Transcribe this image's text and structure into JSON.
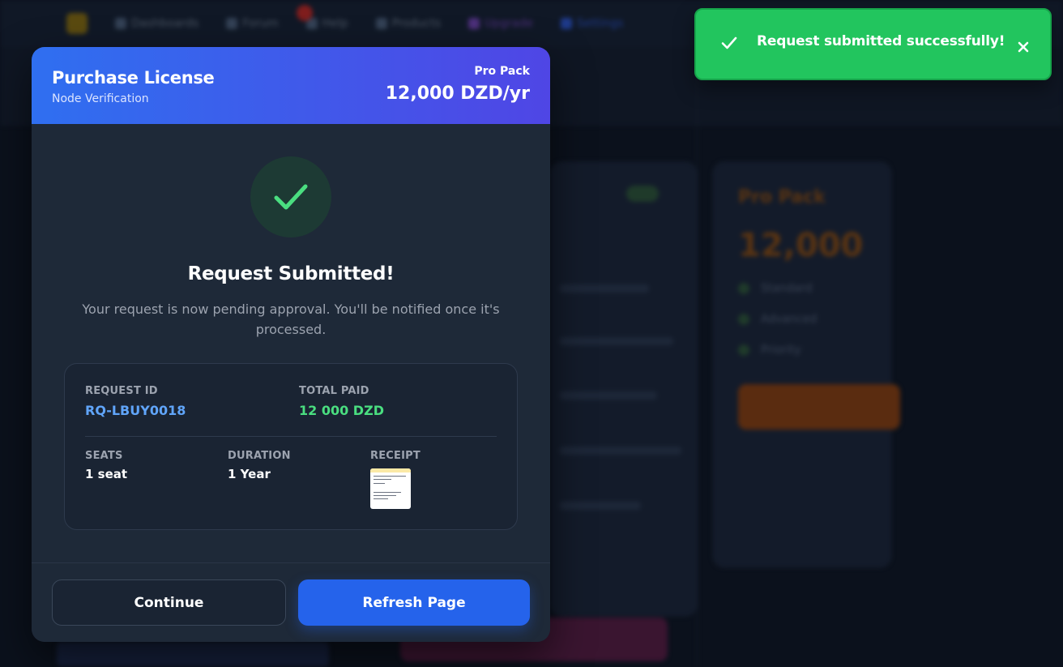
{
  "background": {
    "nav_items": [
      "Dashboards",
      "Forum",
      "Help",
      "Products",
      "Upgrade",
      "Settings"
    ]
  },
  "modal": {
    "title": "Purchase License",
    "subtitle": "Node Verification",
    "pack_label": "Pro Pack",
    "pack_price": "12,000 DZD/yr",
    "success_title": "Request Submitted!",
    "success_text": "Your request is now pending approval. You'll be notified once it's processed.",
    "details": {
      "request_id_label": "REQUEST ID",
      "request_id": "RQ-LBUY0018",
      "total_paid_label": "TOTAL PAID",
      "total_paid": "12 000 DZD",
      "seats_label": "SEATS",
      "seats": "1 seat",
      "duration_label": "DURATION",
      "duration": "1 Year",
      "receipt_label": "RECEIPT"
    },
    "buttons": {
      "continue": "Continue",
      "refresh": "Refresh Page"
    }
  },
  "toast": {
    "message": "Request submitted successfully!"
  },
  "colors": {
    "header_gradient_start": "#2f6ff0",
    "header_gradient_end": "#4f46e5",
    "success_green": "#22c55e",
    "request_id_blue": "#60a5fa",
    "total_paid_green": "#4ade80",
    "primary_button": "#2563eb"
  },
  "icons": {
    "success": "check-icon",
    "toast": "check-icon",
    "toast_close": "close-icon"
  }
}
